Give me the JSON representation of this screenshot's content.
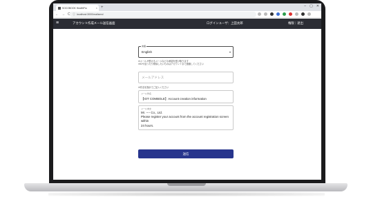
{
  "browser": {
    "tab_title": "SOCOBOOK HealthPro",
    "url": "localhost:3000/mailsend",
    "new_tab": "+",
    "tab_close": "×",
    "window_controls": [
      "–",
      "▢",
      "✕"
    ],
    "nav_icons": [
      "←",
      "→",
      "C"
    ]
  },
  "header": {
    "title": "アカウント作成メール送信画面",
    "login_user": "ログインユーザ：上田太郎",
    "logout": "権限｜退出"
  },
  "form": {
    "language": {
      "label": "言語",
      "value": "English"
    },
    "hint_email": "※メールが受けるメールなどの承認を受け取ります\n※IDや違ったり削除したいものはアカウントまで連絡してください",
    "email": {
      "placeholder": "メールアドレス"
    },
    "hint_subject": "※件名を指示でご記入ください",
    "subject": {
      "label": "メール件名",
      "value": "【IOT COMBOLE】Account creation information"
    },
    "body": {
      "label": "メール本文",
      "value": "Mr. ---- Co., Ltd.\nPlease register your account from the account registration screen within\n24 hours."
    }
  },
  "actions": {
    "send_label": "送信"
  },
  "colors": {
    "header_bg": "#2b2d34",
    "button_bg": "#27358d"
  }
}
